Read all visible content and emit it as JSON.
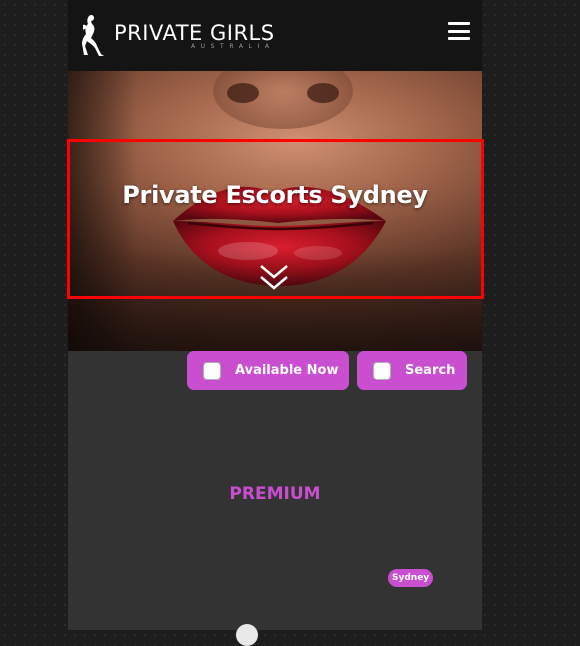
{
  "brand": {
    "name": "PRIVATE GIRLS",
    "subtitle": "AUSTRALIA",
    "logo_icon": "woman-silhouette-icon"
  },
  "header": {
    "menu_icon": "hamburger-menu-icon"
  },
  "hero": {
    "title": "Private Escorts Sydney",
    "scroll_icon": "double-chevron-down-icon"
  },
  "filters": {
    "available_now_label": "Available Now",
    "available_now_checked": false,
    "search_label": "Search",
    "search_checked": false
  },
  "section": {
    "heading": "PREMIUM"
  },
  "listing": {
    "location_tag": "Sydney"
  },
  "colors": {
    "accent": "#c94ed0",
    "header_bg": "#141414",
    "content_bg": "#333333",
    "highlight": "#ff0000"
  }
}
